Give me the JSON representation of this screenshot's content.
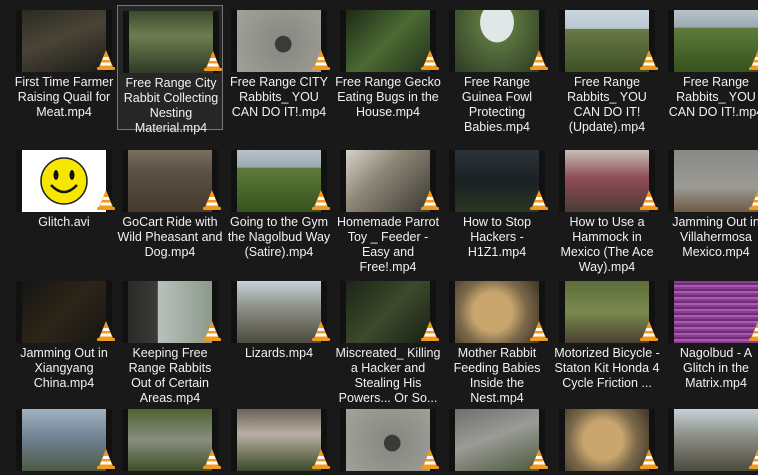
{
  "files": [
    {
      "name": "First Time Farmer Raising Quail for Meat.mp4",
      "thumb": "dark-cage",
      "selected": false
    },
    {
      "name": "Free Range City Rabbit Collecting Nesting Material.mp4",
      "thumb": "green-yard",
      "selected": true
    },
    {
      "name": "Free Range CITY Rabbits_ YOU CAN DO IT!.mp4",
      "thumb": "rabbit-gray",
      "selected": false
    },
    {
      "name": "Free Range Gecko Eating Bugs in the House.mp4",
      "thumb": "plants-dark",
      "selected": false
    },
    {
      "name": "Free Range Guinea Fowl Protecting Babies.mp4",
      "thumb": "fisheye-field",
      "selected": false
    },
    {
      "name": "Free Range Rabbits_ YOU CAN DO IT! (Update).mp4",
      "thumb": "field-sky",
      "selected": false
    },
    {
      "name": "Free Range Rabbits_ YOU CAN DO IT!.mp4",
      "thumb": "field-green",
      "selected": false
    },
    {
      "name": "Glitch.avi",
      "thumb": "smiley",
      "selected": false
    },
    {
      "name": "GoCart Ride with Wild Pheasant and Dog.mp4",
      "thumb": "dirt-road",
      "selected": false
    },
    {
      "name": "Going to the Gym the Nagolbud Way (Satire).mp4",
      "thumb": "field-green",
      "selected": false
    },
    {
      "name": "Homemade Parrot Toy _ Feeder - Easy and Free!.mp4",
      "thumb": "parrot",
      "selected": false
    },
    {
      "name": "How to Stop Hackers - H1Z1.mp4",
      "thumb": "game-dark",
      "selected": false
    },
    {
      "name": "How to Use a Hammock in Mexico (The Ace Way).mp4",
      "thumb": "hammock",
      "selected": false
    },
    {
      "name": "Jamming Out in Villahermosa Mexico.mp4",
      "thumb": "guitar",
      "selected": false
    },
    {
      "name": "Jamming Out in Xiangyang China.mp4",
      "thumb": "dark-room",
      "selected": false
    },
    {
      "name": "Keeping Free Range Rabbits Out of Certain Areas.mp4",
      "thumb": "wall-shadow",
      "selected": false
    },
    {
      "name": "Lizards.mp4",
      "thumb": "lizard",
      "selected": false
    },
    {
      "name": "Miscreated_ Killing a Hacker and Stealing His Powers... Or So...",
      "thumb": "dark-grass",
      "selected": false
    },
    {
      "name": "Mother Rabbit Feeding Babies Inside the Nest.mp4",
      "thumb": "nest",
      "selected": false
    },
    {
      "name": "Motorized Bicycle - Staton Kit Honda 4 Cycle Friction ...",
      "thumb": "bicycle",
      "selected": false
    },
    {
      "name": "Nagolbud - A Glitch in the Matrix.mp4",
      "thumb": "glitch",
      "selected": false
    },
    {
      "name": "",
      "thumb": "cage-blue",
      "selected": false
    },
    {
      "name": "",
      "thumb": "rabbits-grass",
      "selected": false
    },
    {
      "name": "",
      "thumb": "hutch",
      "selected": false
    },
    {
      "name": "",
      "thumb": "rabbit-gray",
      "selected": false
    },
    {
      "name": "",
      "thumb": "wall-gray",
      "selected": false
    },
    {
      "name": "",
      "thumb": "nest",
      "selected": false
    },
    {
      "name": "",
      "thumb": "lizard",
      "selected": false
    }
  ],
  "thumb_styles": {
    "dark-cage": "linear-gradient(160deg,#2b2a22 0%,#4a4436 45%,#1c1c18 100%)",
    "green-yard": "linear-gradient(180deg,#3b4a2e 0%,#6f7d52 40%,#2f3b24 100%)",
    "rabbit-gray": "radial-gradient(circle at 55% 55%,#3a3a36 0 14%,#8a8a84 15%,#a3a39c 100%)",
    "plants-dark": "linear-gradient(135deg,#1c2a18 0%,#4c6a33 50%,#22301a 100%)",
    "fisheye-field": "radial-gradient(ellipse at 50% 20%,#dfe8e6 0 28%,#5b7440 29%,#2d3b22 100%)",
    "field-sky": "linear-gradient(180deg,#c9d6e0 0%,#b8c6cf 30%,#6a7a45 31%,#3f5126 100%)",
    "field-green": "linear-gradient(180deg,#b7c4cc 0%,#9aa8b0 28%,#5f7b3a 29%,#36521e 100%)",
    "smiley": "#ffffff",
    "dirt-road": "linear-gradient(180deg,#7a6f60 0%,#5a5044 35%,#463a2e 100%)",
    "parrot": "linear-gradient(135deg,#d6d2c8 0%,#8d8676 40%,#3d3a33 100%)",
    "game-dark": "linear-gradient(180deg,#2c3338 0%,#1b2024 50%,#2a3522 100%)",
    "hammock": "linear-gradient(180deg,#c6c0b6 0%,#8f4c58 45%,#4b3c35 100%)",
    "guitar": "linear-gradient(180deg,#8a8985 0%,#9b9a95 60%,#6d5a45 100%)",
    "dark-room": "linear-gradient(135deg,#141414 0%,#2e2518 50%,#161616 100%)",
    "wall-shadow": "linear-gradient(90deg,#2a2a28 0%,#3b3b38 35%,#b9c0bd 36%,#8c9a8a 100%)",
    "lizard": "linear-gradient(180deg,#c7d1d6 0%,#8a8d84 45%,#4d4a3f 100%)",
    "dark-grass": "linear-gradient(135deg,#1e2416 0%,#3c4a2c 50%,#1a1f14 100%)",
    "nest": "radial-gradient(circle at 45% 50%,#c8a66d 0 35%,#7d6a4c 60%,#3c3426 100%)",
    "bicycle": "linear-gradient(180deg,#5c6b3c 0%,#7a8a4d 50%,#4a3f33 100%)",
    "glitch": "repeating-linear-gradient(0deg,#8b3d92 0 2px,#a95bb0 2px 4px,#6f2d77 4px 6px)",
    "cage-blue": "linear-gradient(180deg,#9fb2c2 0%,#6d7f8e 50%,#4d5a45 100%)",
    "rabbits-grass": "linear-gradient(180deg,#4d6434 0%,#8a8e80 50%,#3d4f28 100%)",
    "hutch": "linear-gradient(180deg,#6b6258 0%,#b8b0a4 40%,#3a4a28 100%)",
    "wall-gray": "linear-gradient(160deg,#6f706c 0%,#9a9b96 45%,#4d5a3c 100%)"
  }
}
